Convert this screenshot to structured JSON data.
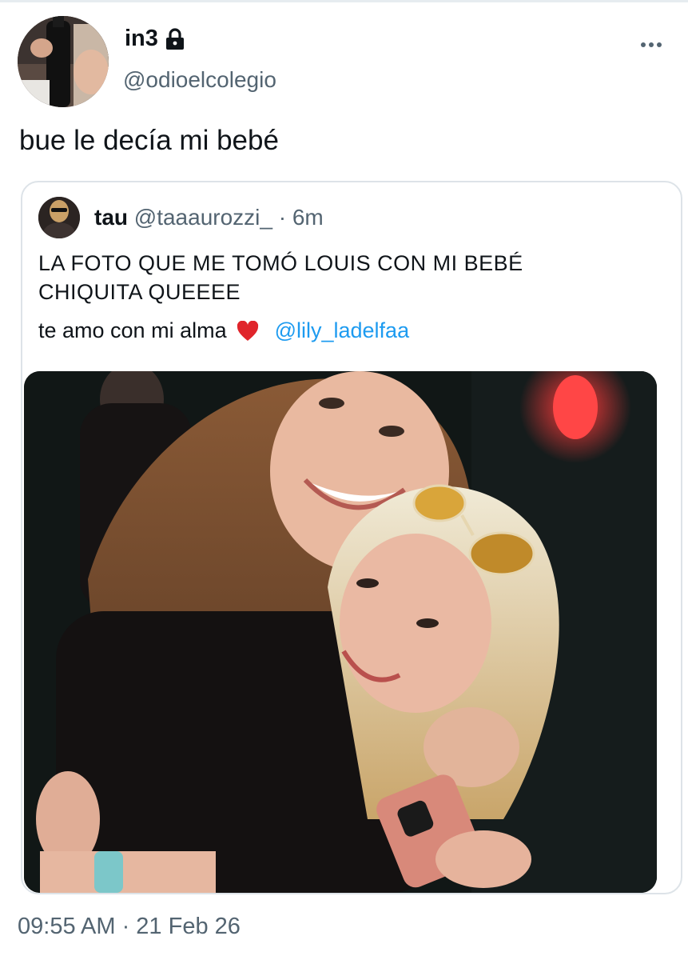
{
  "tweet": {
    "display_name": "in3",
    "handle": "@odioelcolegio",
    "text": "bue le decía mi bebé",
    "timestamp": "09:55 AM · 21 Feb 26",
    "lock_icon": "lock-icon",
    "more_icon": "more-horizontal-icon"
  },
  "quote": {
    "display_name": "tau",
    "handle": "@taaaurozzi_",
    "separator": "·",
    "time": "6m",
    "line1": "LA FOTO QUE ME TOMÓ LOUIS CON MI BEBÉ",
    "line2": "CHIQUITA QUEEEE",
    "line3": "te amo con mi alma",
    "heart_icon": "red-heart-icon",
    "mention": "@lily_ladelfaa",
    "photo_alt": "photo"
  },
  "colors": {
    "text_primary": "#0f1419",
    "text_secondary": "#536471",
    "link": "#1d9bf0",
    "border": "#dde3e8"
  }
}
